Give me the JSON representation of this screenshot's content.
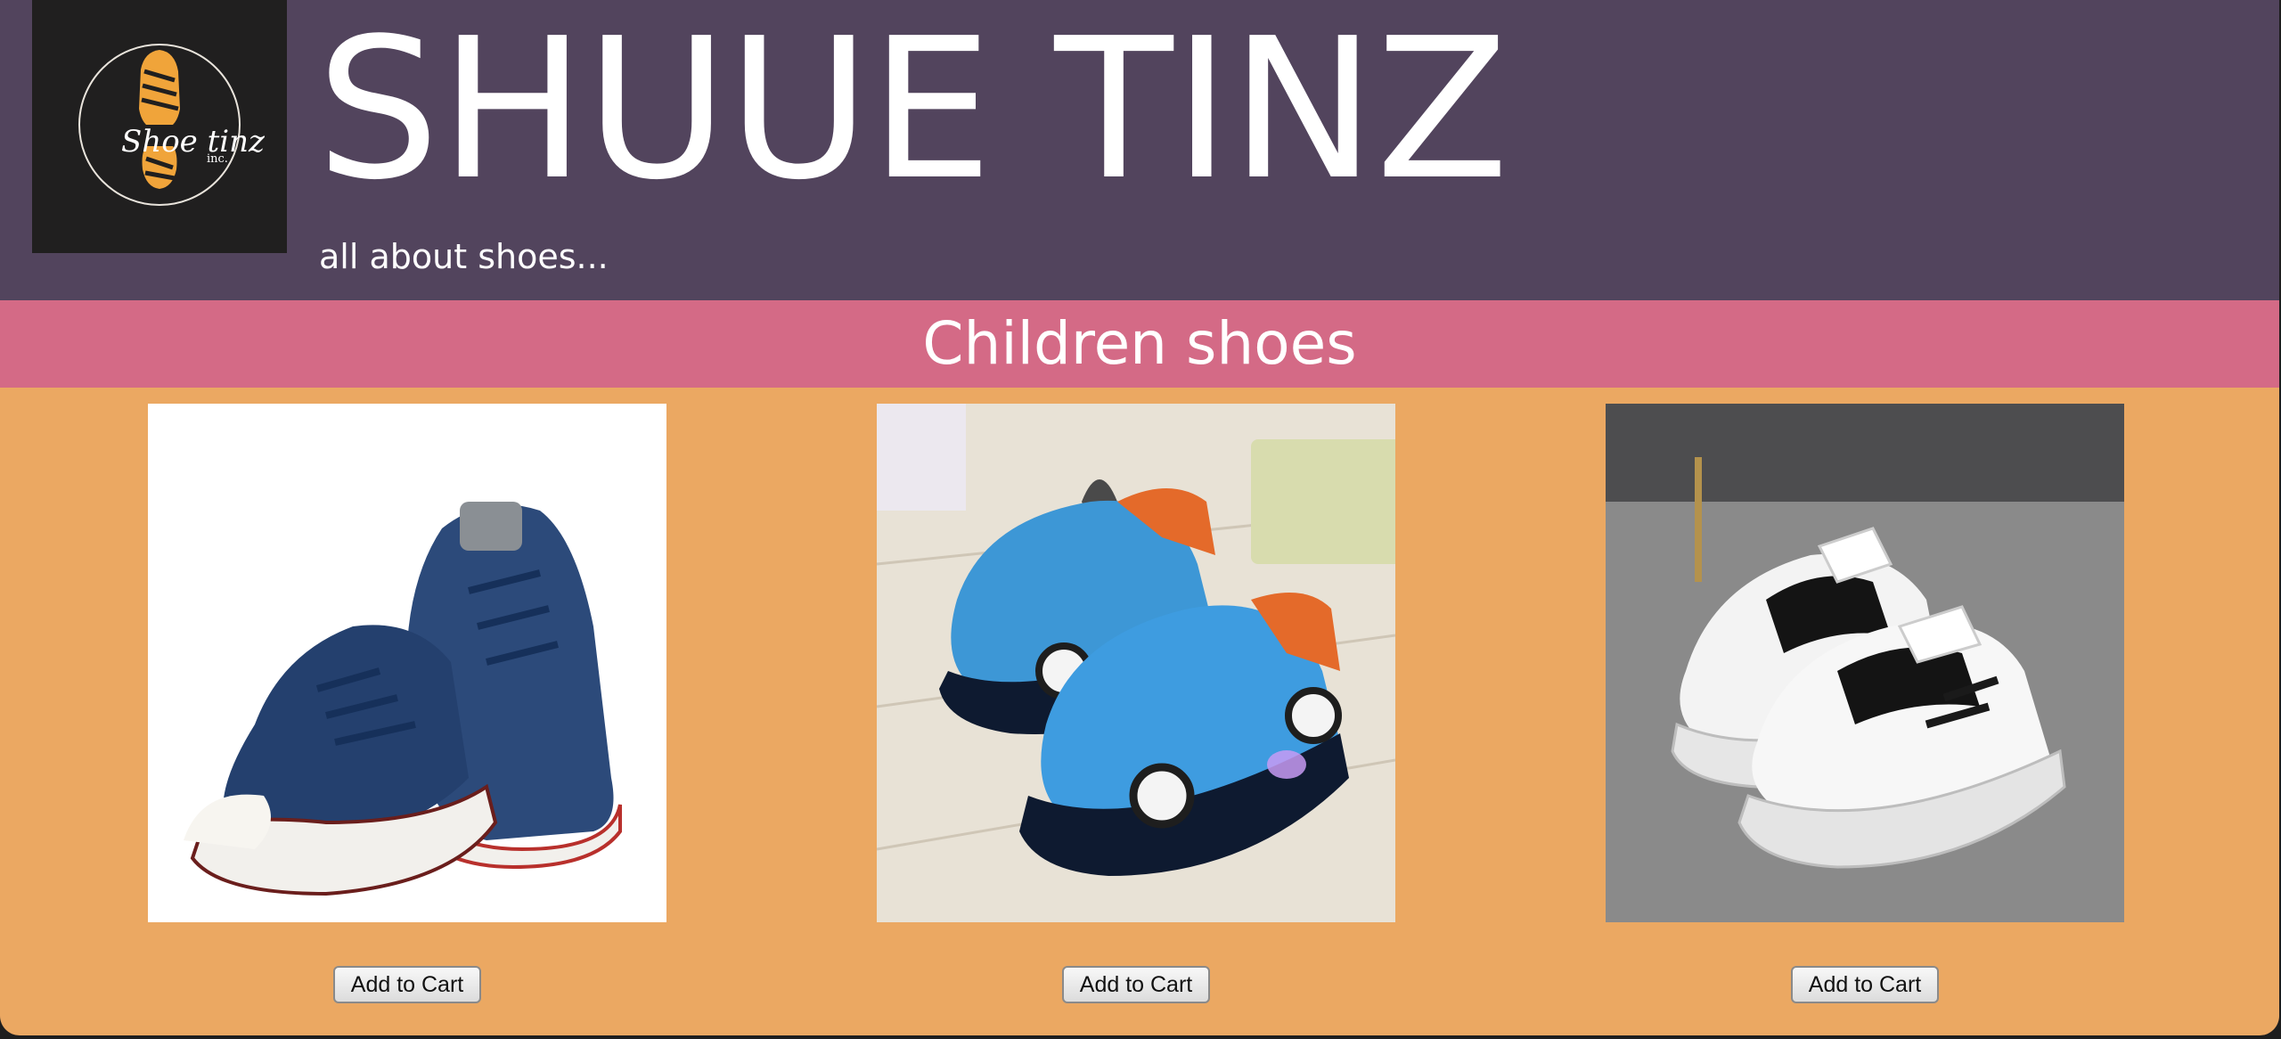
{
  "header": {
    "logo_text": "Shoe tinz",
    "logo_sub": "inc.",
    "title": "SHUUE TINZ",
    "tagline": "all about shoes..."
  },
  "category": {
    "title": "Children shoes"
  },
  "products": [
    {
      "image_icon": "denim-high-top-sneakers-image",
      "button_label": "Add to Cart"
    },
    {
      "image_icon": "blue-race-car-light-up-sneakers-image",
      "button_label": "Add to Cart"
    },
    {
      "image_icon": "white-black-chunky-sneakers-image",
      "button_label": "Add to Cart"
    }
  ],
  "colors": {
    "header_bg": "#52445d",
    "logo_bg": "#201f1f",
    "category_bg": "#d46a86",
    "page_bg": "#eba862",
    "logo_accent": "#f0a43a"
  }
}
